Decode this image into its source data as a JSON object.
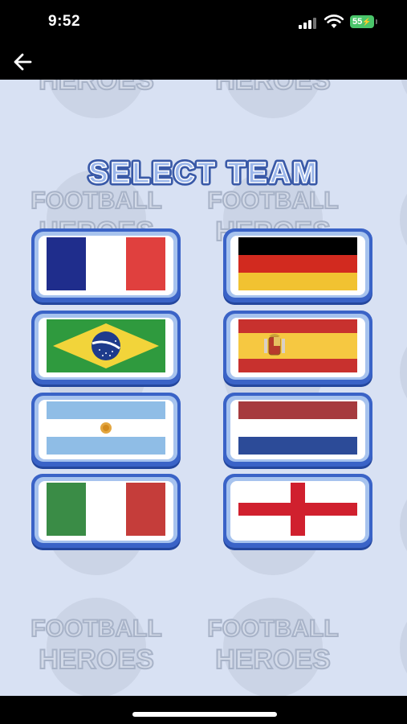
{
  "status_bar": {
    "time": "9:52",
    "battery_level": "55"
  },
  "nav": {
    "back_icon": "arrow-left-icon"
  },
  "screen": {
    "title": "SELECT TEAM",
    "watermark_text_line1": "FOOTBALL",
    "watermark_text_line2": "HEROES"
  },
  "teams": [
    {
      "flag": "france"
    },
    {
      "flag": "germany"
    },
    {
      "flag": "brazil"
    },
    {
      "flag": "spain"
    },
    {
      "flag": "argentina"
    },
    {
      "flag": "netherlands"
    },
    {
      "flag": "italy"
    },
    {
      "flag": "england"
    }
  ],
  "colors": {
    "background": "#d8e1f3",
    "button_border": "#3a63c7",
    "title_fill": "#6e8fd9",
    "title_outline": "#2d4a9a"
  }
}
